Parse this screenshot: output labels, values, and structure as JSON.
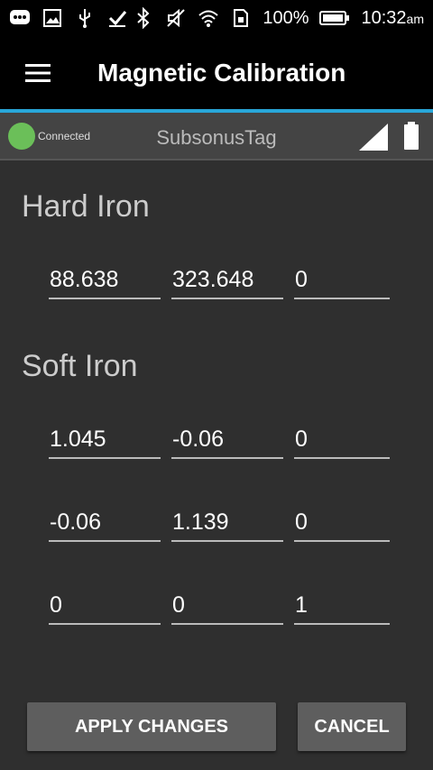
{
  "status_bar": {
    "battery_percent": "100%",
    "time": "10:32",
    "time_suffix": "am",
    "icons": [
      "chat-icon",
      "image-icon",
      "usb-icon",
      "download-icon",
      "bluetooth-icon",
      "mute-icon",
      "wifi-icon",
      "sim-icon",
      "battery-icon"
    ]
  },
  "appbar": {
    "title": "Magnetic Calibration",
    "menu_icon": "hamburger-menu-icon",
    "accent_color": "#29a7d9"
  },
  "device": {
    "status": "Connected",
    "status_color": "#6bbf59",
    "name": "SubsonusTag"
  },
  "hard_iron": {
    "title": "Hard Iron",
    "values": [
      "88.638",
      "323.648",
      "0"
    ]
  },
  "soft_iron": {
    "title": "Soft Iron",
    "rows": [
      [
        "1.045",
        "-0.06",
        "0"
      ],
      [
        "-0.06",
        "1.139",
        "0"
      ],
      [
        "0",
        "0",
        "1"
      ]
    ]
  },
  "buttons": {
    "apply": "APPLY CHANGES",
    "cancel": "CANCEL"
  }
}
